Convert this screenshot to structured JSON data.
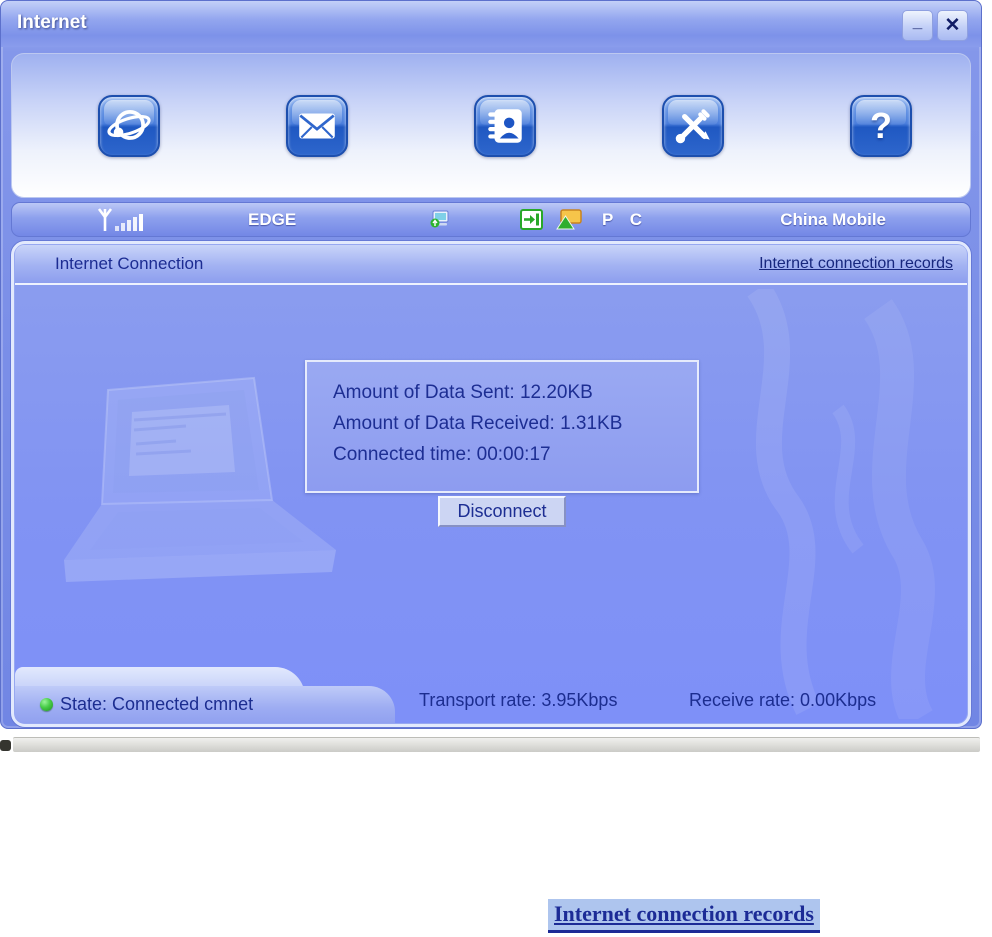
{
  "window": {
    "title": "Internet",
    "minimize_glyph": "_",
    "close_glyph": "✕"
  },
  "toolbar": {
    "buttons": [
      {
        "name": "internet"
      },
      {
        "name": "sms"
      },
      {
        "name": "phonebook"
      },
      {
        "name": "settings"
      },
      {
        "name": "help",
        "glyph": "?"
      }
    ]
  },
  "statusbar": {
    "network_type": "EDGE",
    "device_label": "P C",
    "carrier": "China Mobile"
  },
  "main": {
    "header_title": "Internet Connection",
    "records_link": "Internet connection records",
    "info_lines": [
      "Amount of Data Sent: 12.20KB",
      "Amount of Data Received: 1.31KB",
      "Connected time: 00:00:17"
    ],
    "disconnect_label": "Disconnect",
    "state": "State: Connected cmnet",
    "transport_rate": "Transport rate: 3.95Kbps",
    "receive_rate": "Receive rate: 0.00Kbps"
  },
  "caption_link": "Internet connection records",
  "colors": {
    "accent_navy": "#1d2e93",
    "panel_blue": "#8092f4",
    "glossy_icon_blue": "#2f66cc",
    "status_green": "#2fb32f",
    "selection_highlight": "#aec5ee",
    "carrier_text": "#ffffff"
  }
}
